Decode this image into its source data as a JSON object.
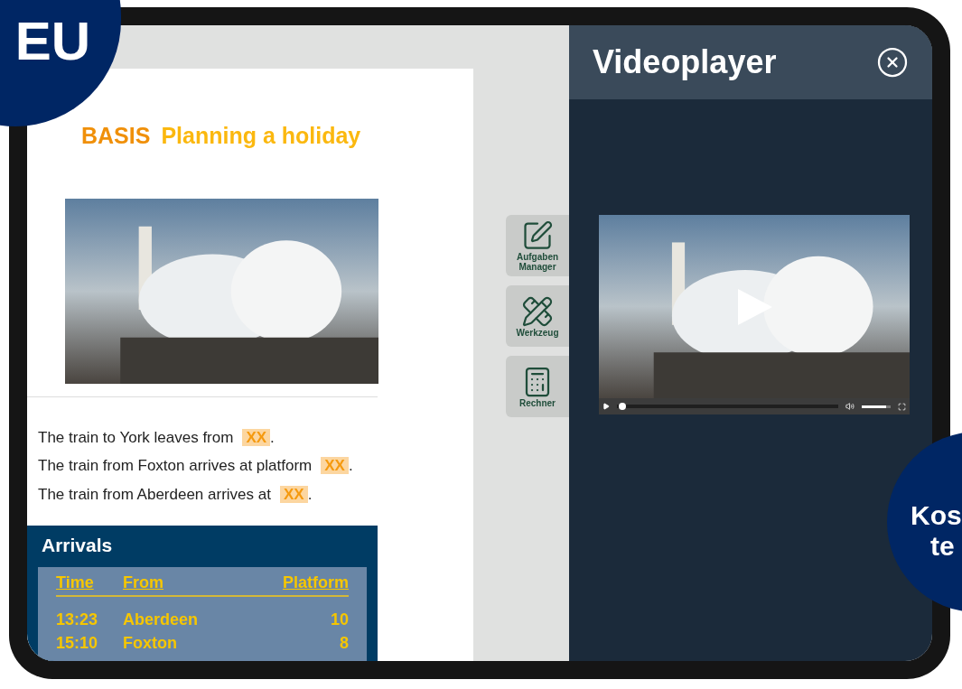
{
  "badge_top": {
    "text": "EU"
  },
  "lesson": {
    "level": "BASIS",
    "title": "Planning a holiday",
    "sentences": [
      {
        "before": "The train to York leaves from",
        "blank": "XX",
        "after": "."
      },
      {
        "before": "The train from Foxton arrives at platform",
        "blank": "XX",
        "after": "."
      },
      {
        "before": "The train from Aberdeen arrives at",
        "blank": "XX",
        "after": "."
      }
    ],
    "arrivals": {
      "title": "Arrivals",
      "columns": [
        "Time",
        "From",
        "Platform"
      ],
      "rows": [
        [
          "13:23",
          "Aberdeen",
          "10"
        ],
        [
          "15:10",
          "Foxton",
          "8"
        ]
      ]
    }
  },
  "tools": [
    {
      "kind": "tasks",
      "label": "Aufgaben Manager"
    },
    {
      "kind": "tools",
      "label": "Werkzeug"
    },
    {
      "kind": "calculator",
      "label": "Rechner"
    }
  ],
  "videoplayer": {
    "title": "Videoplayer",
    "progress": {
      "level": 0.01
    },
    "volume": {
      "level": 0.85
    }
  },
  "badge_side": {
    "lines": [
      "Kos",
      "te"
    ]
  }
}
